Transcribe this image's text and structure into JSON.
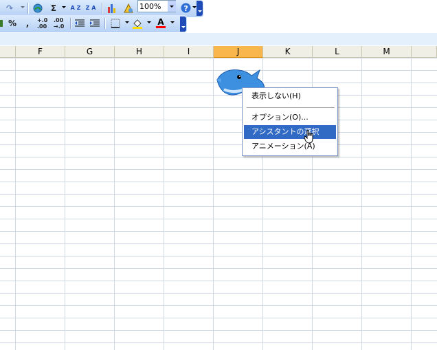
{
  "toolbar1": {
    "zoom_value": "100%",
    "autosum_symbol": "Σ",
    "sort_asc_label": "A Z",
    "sort_desc_label": "Z A"
  },
  "toolbar2": {
    "percent_symbol": "%",
    "comma_symbol": ",",
    "inc_decimal_label": "+.0 .00",
    "dec_decimal_label": ".00 →.0",
    "font_color_letter": "A"
  },
  "columns": [
    "F",
    "G",
    "H",
    "I",
    "J",
    "K",
    "L",
    "M"
  ],
  "selected_column": "J",
  "context_menu": {
    "items": [
      {
        "label": "表示しない(H)"
      },
      {
        "label": "オプション(O)..."
      },
      {
        "label": "アシスタントの選択(C)..."
      },
      {
        "label": "アニメーション(A)"
      }
    ],
    "highlighted_index": 2
  },
  "colors": {
    "toolbar_bg": "#c8dcf7",
    "selected_column": "#f9b64c",
    "menu_highlight": "#316ac5",
    "gridline": "#d0d7e5"
  }
}
